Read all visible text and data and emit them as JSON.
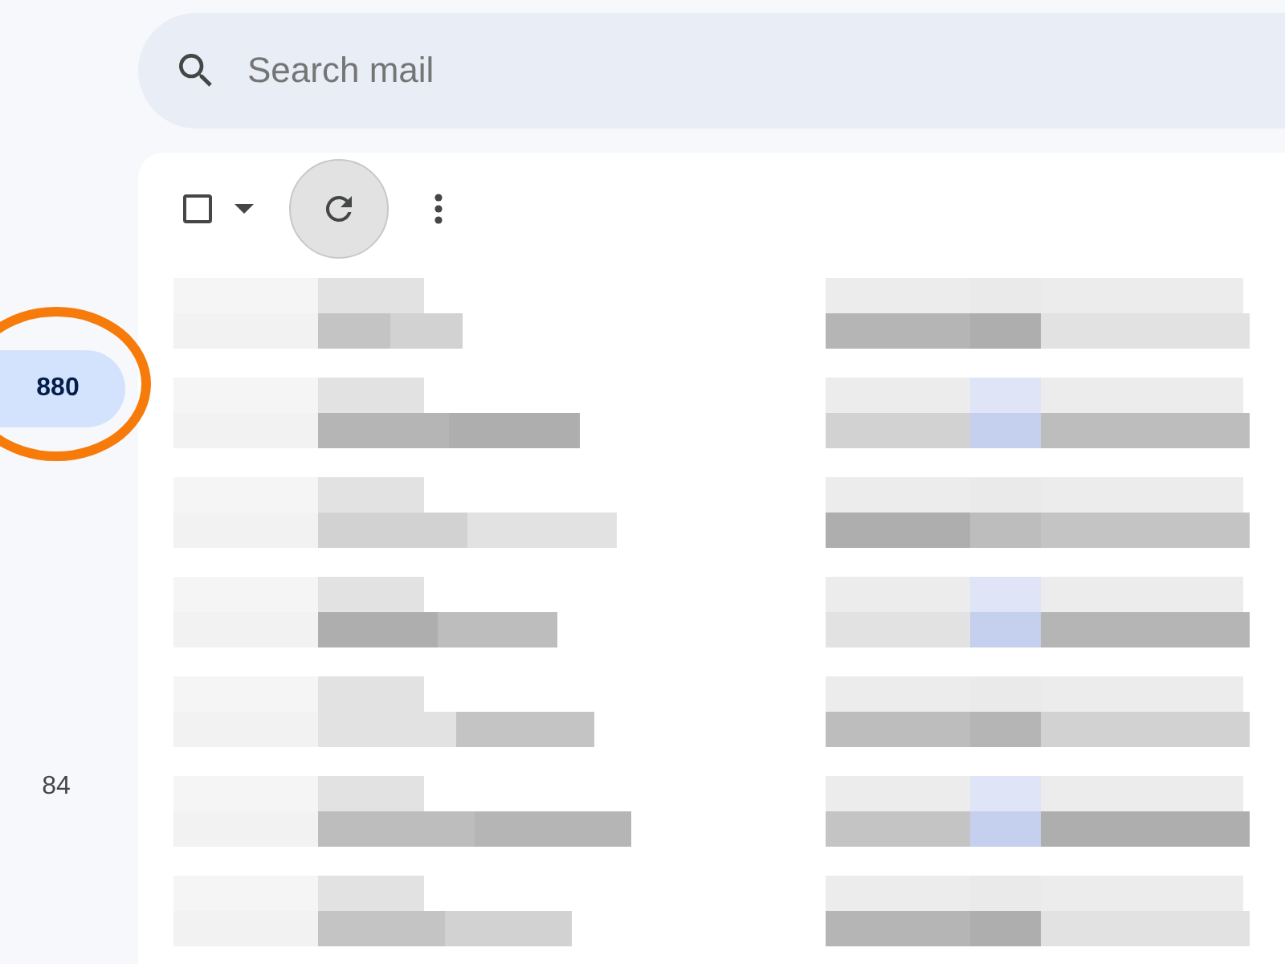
{
  "search": {
    "placeholder": "Search mail"
  },
  "toolbar": {
    "select_all": {
      "checked": false
    }
  },
  "sidebar": {
    "items": [
      {
        "count": "880",
        "selected": true
      },
      {
        "count": "84",
        "selected": false
      }
    ]
  }
}
